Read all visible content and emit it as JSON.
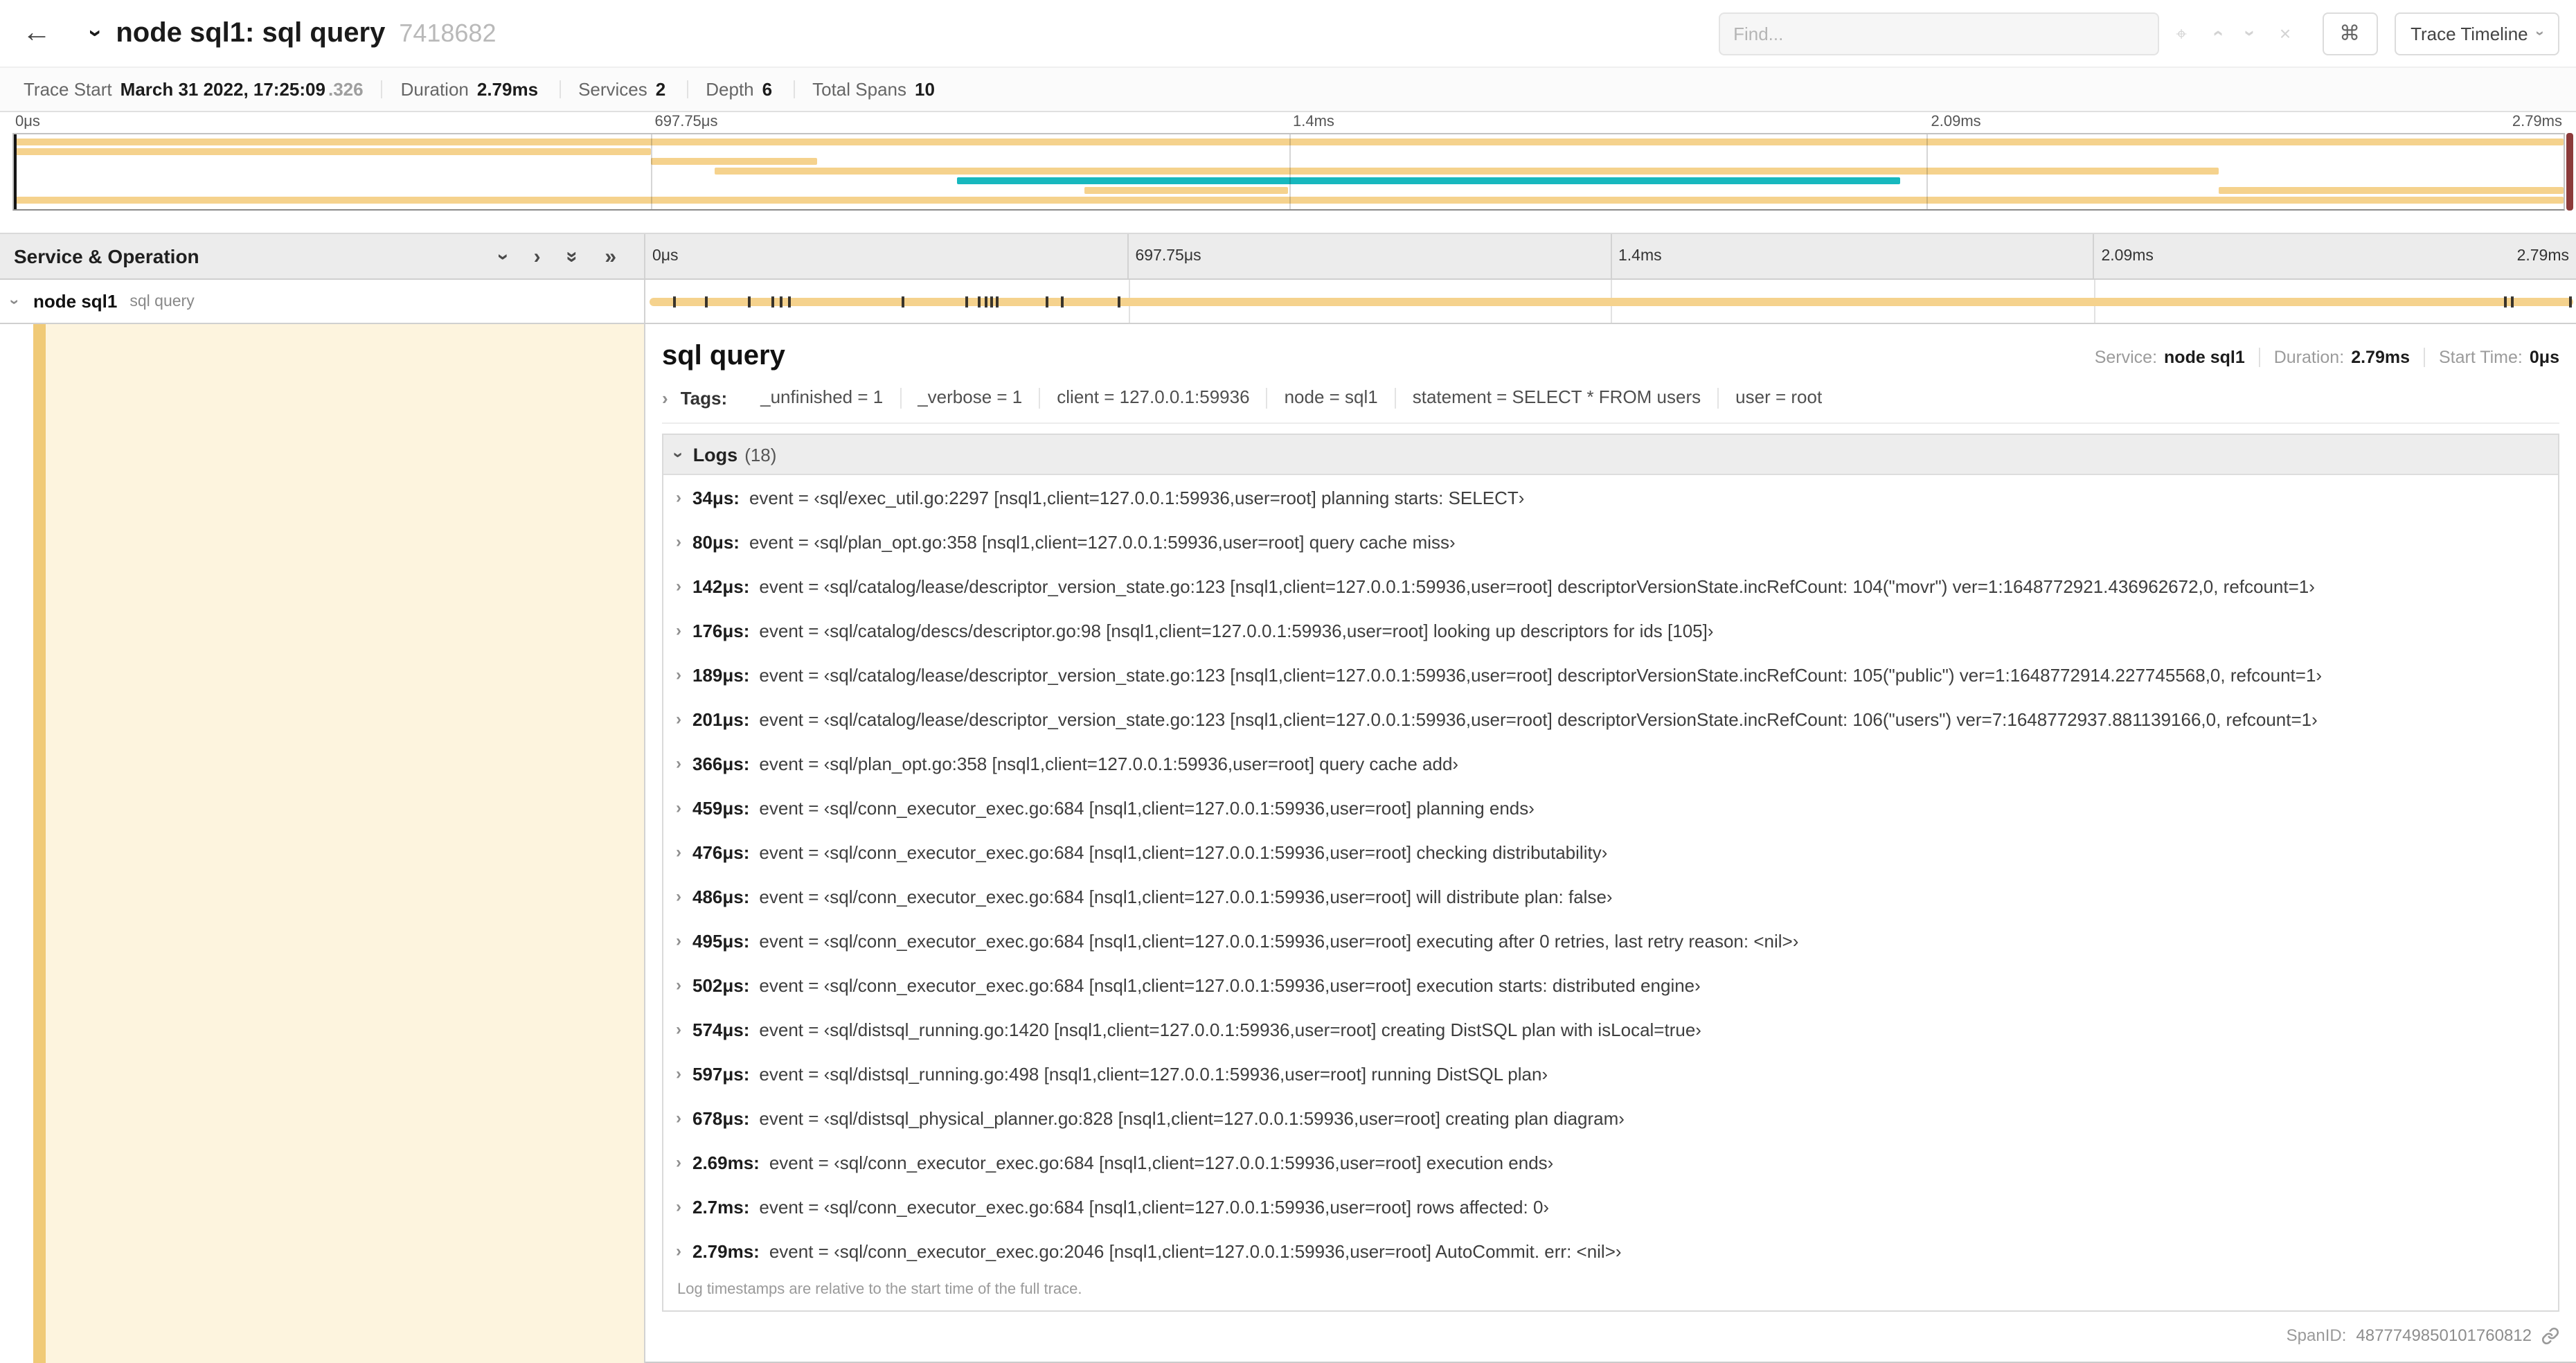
{
  "colors": {
    "tan": "#f5d28d",
    "teal": "#17b8be",
    "accent_stripe": "#f0ca77",
    "detail_bg": "#fdf4de",
    "scrollbar": "#8c3a3a"
  },
  "topbar": {
    "title": "node sql1: sql query",
    "trace_id": "7418682",
    "find_placeholder": "Find...",
    "keyboard_shortcut": "⌘",
    "view_selector": "Trace Timeline"
  },
  "summary": {
    "items": [
      {
        "label": "Trace Start",
        "value": "March 31 2022, 17:25:09",
        "suffix": ".326"
      },
      {
        "label": "Duration",
        "value": "2.79ms"
      },
      {
        "label": "Services",
        "value": "2"
      },
      {
        "label": "Depth",
        "value": "6"
      },
      {
        "label": "Total Spans",
        "value": "10"
      }
    ]
  },
  "time_ticks": [
    "0μs",
    "697.75μs",
    "1.4ms",
    "2.09ms",
    "2.79ms"
  ],
  "minimap": {
    "bars": [
      {
        "row": 0,
        "start": 0,
        "width": 100,
        "color": "tan"
      },
      {
        "row": 1,
        "start": 0,
        "width": 25,
        "color": "tan"
      },
      {
        "row": 2,
        "start": 25,
        "width": 6.5,
        "color": "tan"
      },
      {
        "row": 3,
        "start": 27.5,
        "width": 59,
        "color": "tan"
      },
      {
        "row": 4,
        "start": 37,
        "width": 37,
        "color": "teal"
      },
      {
        "row": 5,
        "start": 42,
        "width": 8,
        "color": "tan"
      },
      {
        "row": 5,
        "start": 86.5,
        "width": 13.5,
        "color": "tan"
      },
      {
        "row": 6,
        "start": 0,
        "width": 100,
        "color": "tan"
      }
    ]
  },
  "timeline": {
    "left_header": "Service & Operation",
    "span": {
      "service": "node sql1",
      "operation": "sql query",
      "marks_pct": [
        1.22,
        2.87,
        5.09,
        6.31,
        6.77,
        7.2,
        13.12,
        16.45,
        17.06,
        17.42,
        17.74,
        17.99,
        20.57,
        21.4,
        24.3,
        96.42,
        96.77,
        99.75
      ]
    }
  },
  "detail": {
    "title": "sql query",
    "meta": [
      {
        "label": "Service:",
        "value": "node sql1"
      },
      {
        "label": "Duration:",
        "value": "2.79ms"
      },
      {
        "label": "Start Time:",
        "value": "0μs"
      }
    ],
    "tags_label": "Tags:",
    "tags": [
      {
        "text": "_unfinished = 1"
      },
      {
        "text": "_verbose = 1"
      },
      {
        "text": "client = 127.0.0.1:59936"
      },
      {
        "text": "node = sql1"
      },
      {
        "text": "statement = SELECT * FROM users"
      },
      {
        "text": "user = root"
      }
    ],
    "logs_label": "Logs",
    "logs_count": "(18)",
    "logs": [
      {
        "time": "34μs:",
        "text": "event = ‹sql/exec_util.go:2297 [nsql1,client=127.0.0.1:59936,user=root] planning starts: SELECT›"
      },
      {
        "time": "80μs:",
        "text": "event = ‹sql/plan_opt.go:358 [nsql1,client=127.0.0.1:59936,user=root] query cache miss›"
      },
      {
        "time": "142μs:",
        "text": "event = ‹sql/catalog/lease/descriptor_version_state.go:123 [nsql1,client=127.0.0.1:59936,user=root] descriptorVersionState.incRefCount: 104(\"movr\") ver=1:1648772921.436962672,0, refcount=1›"
      },
      {
        "time": "176μs:",
        "text": "event = ‹sql/catalog/descs/descriptor.go:98 [nsql1,client=127.0.0.1:59936,user=root] looking up descriptors for ids [105]›"
      },
      {
        "time": "189μs:",
        "text": "event = ‹sql/catalog/lease/descriptor_version_state.go:123 [nsql1,client=127.0.0.1:59936,user=root] descriptorVersionState.incRefCount: 105(\"public\") ver=1:1648772914.227745568,0, refcount=1›"
      },
      {
        "time": "201μs:",
        "text": "event = ‹sql/catalog/lease/descriptor_version_state.go:123 [nsql1,client=127.0.0.1:59936,user=root] descriptorVersionState.incRefCount: 106(\"users\") ver=7:1648772937.881139166,0, refcount=1›"
      },
      {
        "time": "366μs:",
        "text": "event = ‹sql/plan_opt.go:358 [nsql1,client=127.0.0.1:59936,user=root] query cache add›"
      },
      {
        "time": "459μs:",
        "text": "event = ‹sql/conn_executor_exec.go:684 [nsql1,client=127.0.0.1:59936,user=root] planning ends›"
      },
      {
        "time": "476μs:",
        "text": "event = ‹sql/conn_executor_exec.go:684 [nsql1,client=127.0.0.1:59936,user=root] checking distributability›"
      },
      {
        "time": "486μs:",
        "text": "event = ‹sql/conn_executor_exec.go:684 [nsql1,client=127.0.0.1:59936,user=root] will distribute plan: false›"
      },
      {
        "time": "495μs:",
        "text": "event = ‹sql/conn_executor_exec.go:684 [nsql1,client=127.0.0.1:59936,user=root] executing after 0 retries, last retry reason: <nil>›"
      },
      {
        "time": "502μs:",
        "text": "event = ‹sql/conn_executor_exec.go:684 [nsql1,client=127.0.0.1:59936,user=root] execution starts: distributed engine›"
      },
      {
        "time": "574μs:",
        "text": "event = ‹sql/distsql_running.go:1420 [nsql1,client=127.0.0.1:59936,user=root] creating DistSQL plan with isLocal=true›"
      },
      {
        "time": "597μs:",
        "text": "event = ‹sql/distsql_running.go:498 [nsql1,client=127.0.0.1:59936,user=root] running DistSQL plan›"
      },
      {
        "time": "678μs:",
        "text": "event = ‹sql/distsql_physical_planner.go:828 [nsql1,client=127.0.0.1:59936,user=root] creating plan diagram›"
      },
      {
        "time": "2.69ms:",
        "text": "event = ‹sql/conn_executor_exec.go:684 [nsql1,client=127.0.0.1:59936,user=root] execution ends›"
      },
      {
        "time": "2.7ms:",
        "text": "event = ‹sql/conn_executor_exec.go:684 [nsql1,client=127.0.0.1:59936,user=root] rows affected: 0›"
      },
      {
        "time": "2.79ms:",
        "text": "event = ‹sql/conn_executor_exec.go:2046 [nsql1,client=127.0.0.1:59936,user=root] AutoCommit. err: <nil>›"
      }
    ],
    "footer_note": "Log timestamps are relative to the start time of the full trace.",
    "span_id_label": "SpanID:",
    "span_id": "4877749850101760812"
  }
}
